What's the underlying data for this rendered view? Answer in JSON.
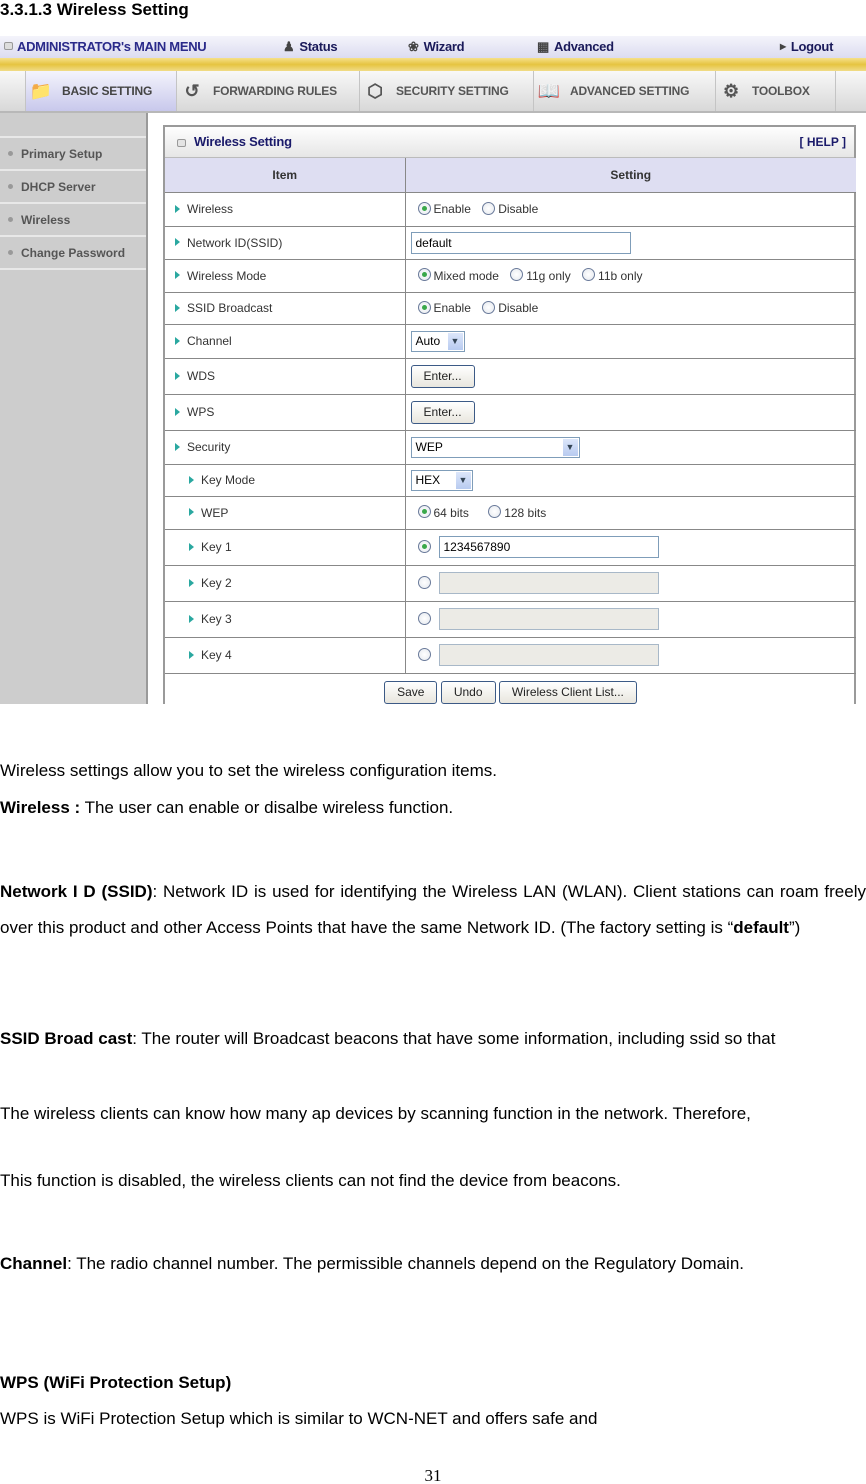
{
  "document": {
    "section_title": "3.3.1.3 Wireless Setting",
    "page_number": "31"
  },
  "router_ui": {
    "topbar": {
      "admin_menu": "ADMINISTRATOR's MAIN MENU",
      "links": [
        {
          "label": "Status",
          "icon": "status-person-icon"
        },
        {
          "label": "Wizard",
          "icon": "wizard-icon"
        },
        {
          "label": "Advanced",
          "icon": "advanced-icon"
        },
        {
          "label": "Logout",
          "icon": "triangle-right-icon"
        }
      ]
    },
    "tabs": [
      {
        "label": "BASIC SETTING",
        "icon": "folder-icon",
        "active": true
      },
      {
        "label": "FORWARDING RULES",
        "icon": "arrows-icon",
        "active": false
      },
      {
        "label": "SECURITY SETTING",
        "icon": "lock-nut-icon",
        "active": false
      },
      {
        "label": "ADVANCED SETTING",
        "icon": "book-icon",
        "active": false
      },
      {
        "label": "TOOLBOX",
        "icon": "gear-toolbox-icon",
        "active": false
      }
    ],
    "sidebar": [
      {
        "label": "Primary Setup"
      },
      {
        "label": "DHCP Server"
      },
      {
        "label": "Wireless"
      },
      {
        "label": "Change Password"
      }
    ],
    "panel": {
      "title": "Wireless Setting",
      "help": "[ HELP ]",
      "col_item": "Item",
      "col_setting": "Setting",
      "rows": {
        "wireless": {
          "label": "Wireless",
          "options": [
            "Enable",
            "Disable"
          ],
          "selected": "Enable"
        },
        "ssid": {
          "label": "Network ID(SSID)",
          "value": "default"
        },
        "mode": {
          "label": "Wireless Mode",
          "options": [
            "Mixed mode",
            "11g only",
            "11b only"
          ],
          "selected": "Mixed mode"
        },
        "broadcast": {
          "label": "SSID Broadcast",
          "options": [
            "Enable",
            "Disable"
          ],
          "selected": "Enable"
        },
        "channel": {
          "label": "Channel",
          "value": "Auto"
        },
        "wds": {
          "label": "WDS",
          "button": "Enter..."
        },
        "wps": {
          "label": "WPS",
          "button": "Enter..."
        },
        "security": {
          "label": "Security",
          "value": "WEP"
        },
        "key_mode": {
          "label": "Key Mode",
          "value": "HEX"
        },
        "wep": {
          "label": "WEP",
          "options": [
            "64 bits",
            "128 bits"
          ],
          "selected": "64 bits"
        },
        "key1": {
          "label": "Key 1",
          "value": "1234567890",
          "selected": true
        },
        "key2": {
          "label": "Key 2",
          "value": "",
          "selected": false
        },
        "key3": {
          "label": "Key 3",
          "value": "",
          "selected": false
        },
        "key4": {
          "label": "Key 4",
          "value": "",
          "selected": false
        }
      },
      "buttons": {
        "save": "Save",
        "undo": "Undo",
        "client_list": "Wireless Client List..."
      }
    }
  },
  "body": {
    "intro": "Wireless settings allow you to set the wireless configuration items.",
    "wireless_term": "Wireless :",
    "wireless_desc": " The user can enable or disalbe wireless function.",
    "ssid_term": "Network I D  (SSID)",
    "ssid_desc": ": Network ID is used for identifying the Wireless LAN (WLAN). Client stations can roam freely over this product and other Access Points that have the same Network ID. (The factory setting is “",
    "ssid_default": "default",
    "ssid_end": "”)",
    "broadcast_term": "SSID Broad cast",
    "broadcast_desc1": ": The router will Broadcast beacons that have some information, including ssid so that",
    "broadcast_desc2": "The wireless clients can know how many ap devices by scanning function in the network. Therefore,",
    "broadcast_desc3": "This function is disabled, the wireless clients can not find the device from beacons.",
    "channel_term": "Channel",
    "channel_desc": ": The radio channel number. The permissible channels depend on the Regulatory Domain.",
    "wps_heading": "WPS (WiFi Protection Setup)",
    "wps_desc": "WPS is WiFi Protection Setup which is similar to WCN-NET and offers safe and"
  }
}
